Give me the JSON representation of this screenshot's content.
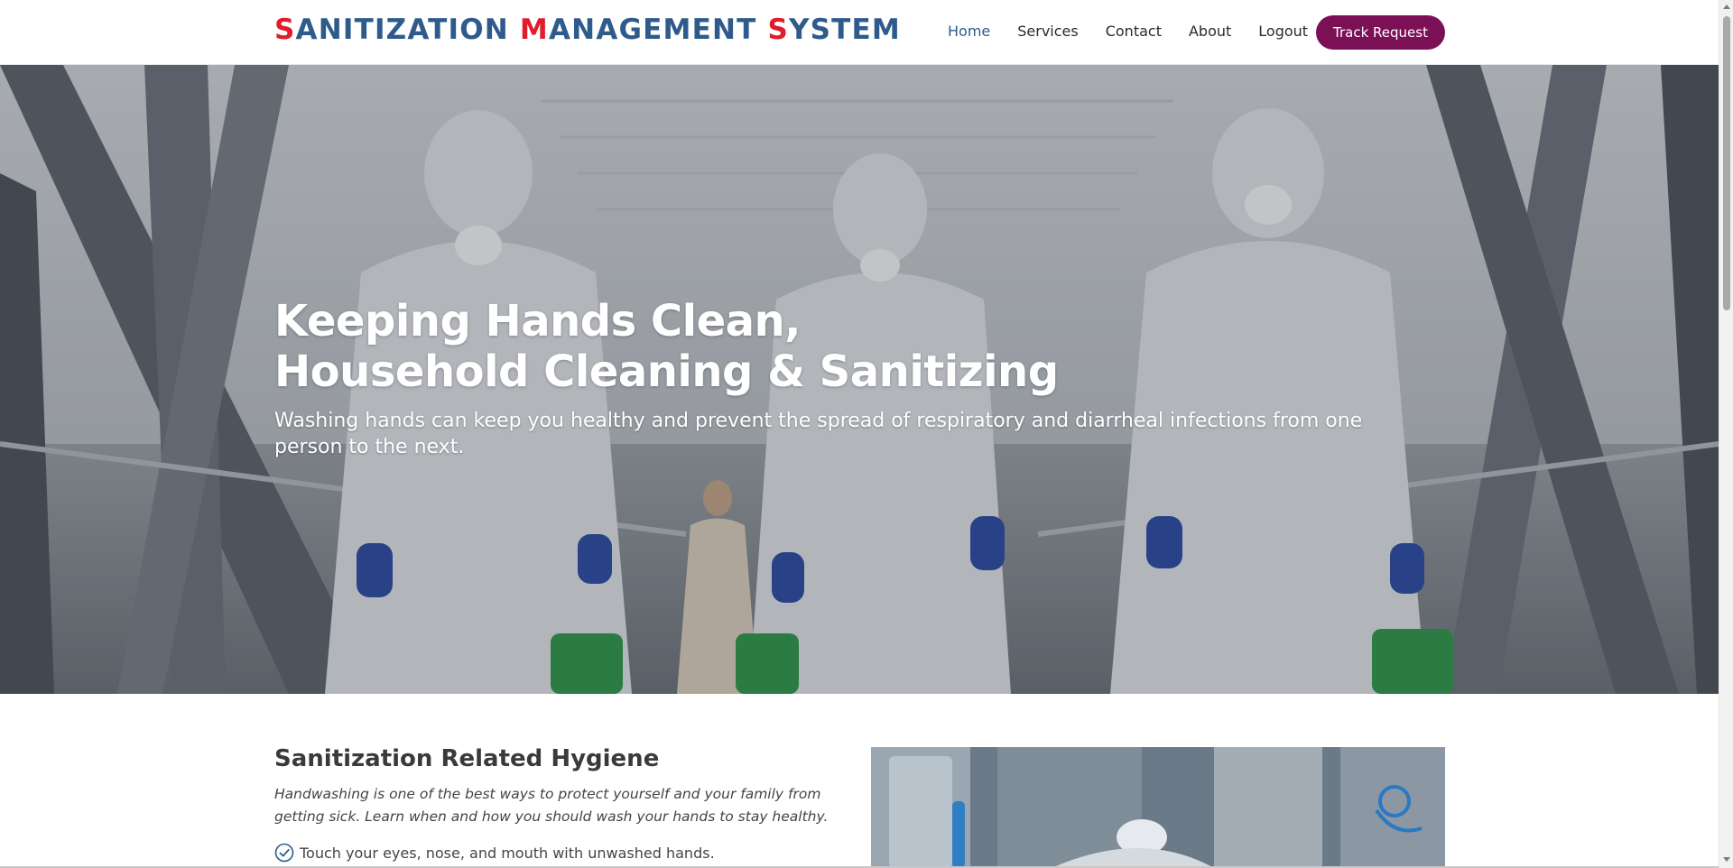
{
  "header": {
    "logo_parts": [
      {
        "text": "S",
        "accent": true
      },
      {
        "text": "ANITIZATION ",
        "accent": false
      },
      {
        "text": "M",
        "accent": true
      },
      {
        "text": "ANAGEMENT ",
        "accent": false
      },
      {
        "text": "S",
        "accent": true
      },
      {
        "text": "YSTEM",
        "accent": false
      }
    ],
    "nav": [
      {
        "label": "Home",
        "active": true
      },
      {
        "label": "Services",
        "active": false
      },
      {
        "label": "Contact",
        "active": false
      },
      {
        "label": "About",
        "active": false
      },
      {
        "label": "Logout",
        "active": false
      }
    ],
    "cta_label": "Track Request"
  },
  "hero": {
    "title_line1": "Keeping Hands Clean,",
    "title_line2": "Household Cleaning & Sanitizing",
    "subtitle": "Washing hands can keep you healthy and prevent the spread of respiratory and diarrheal infections from one person to the next."
  },
  "section": {
    "title": "Sanitization Related Hygiene",
    "description": "Handwashing is one of the best ways to protect yourself and your family from getting sick. Learn when and how you should wash your hands to stay healthy.",
    "check_items": [
      "Touch your eyes, nose, and mouth with unwashed hands."
    ]
  },
  "colors": {
    "brand_blue": "#2e5b8c",
    "accent_red": "#e01e2b",
    "cta_purple": "#7b1057"
  },
  "icons": {
    "check": "check-circle-icon"
  }
}
